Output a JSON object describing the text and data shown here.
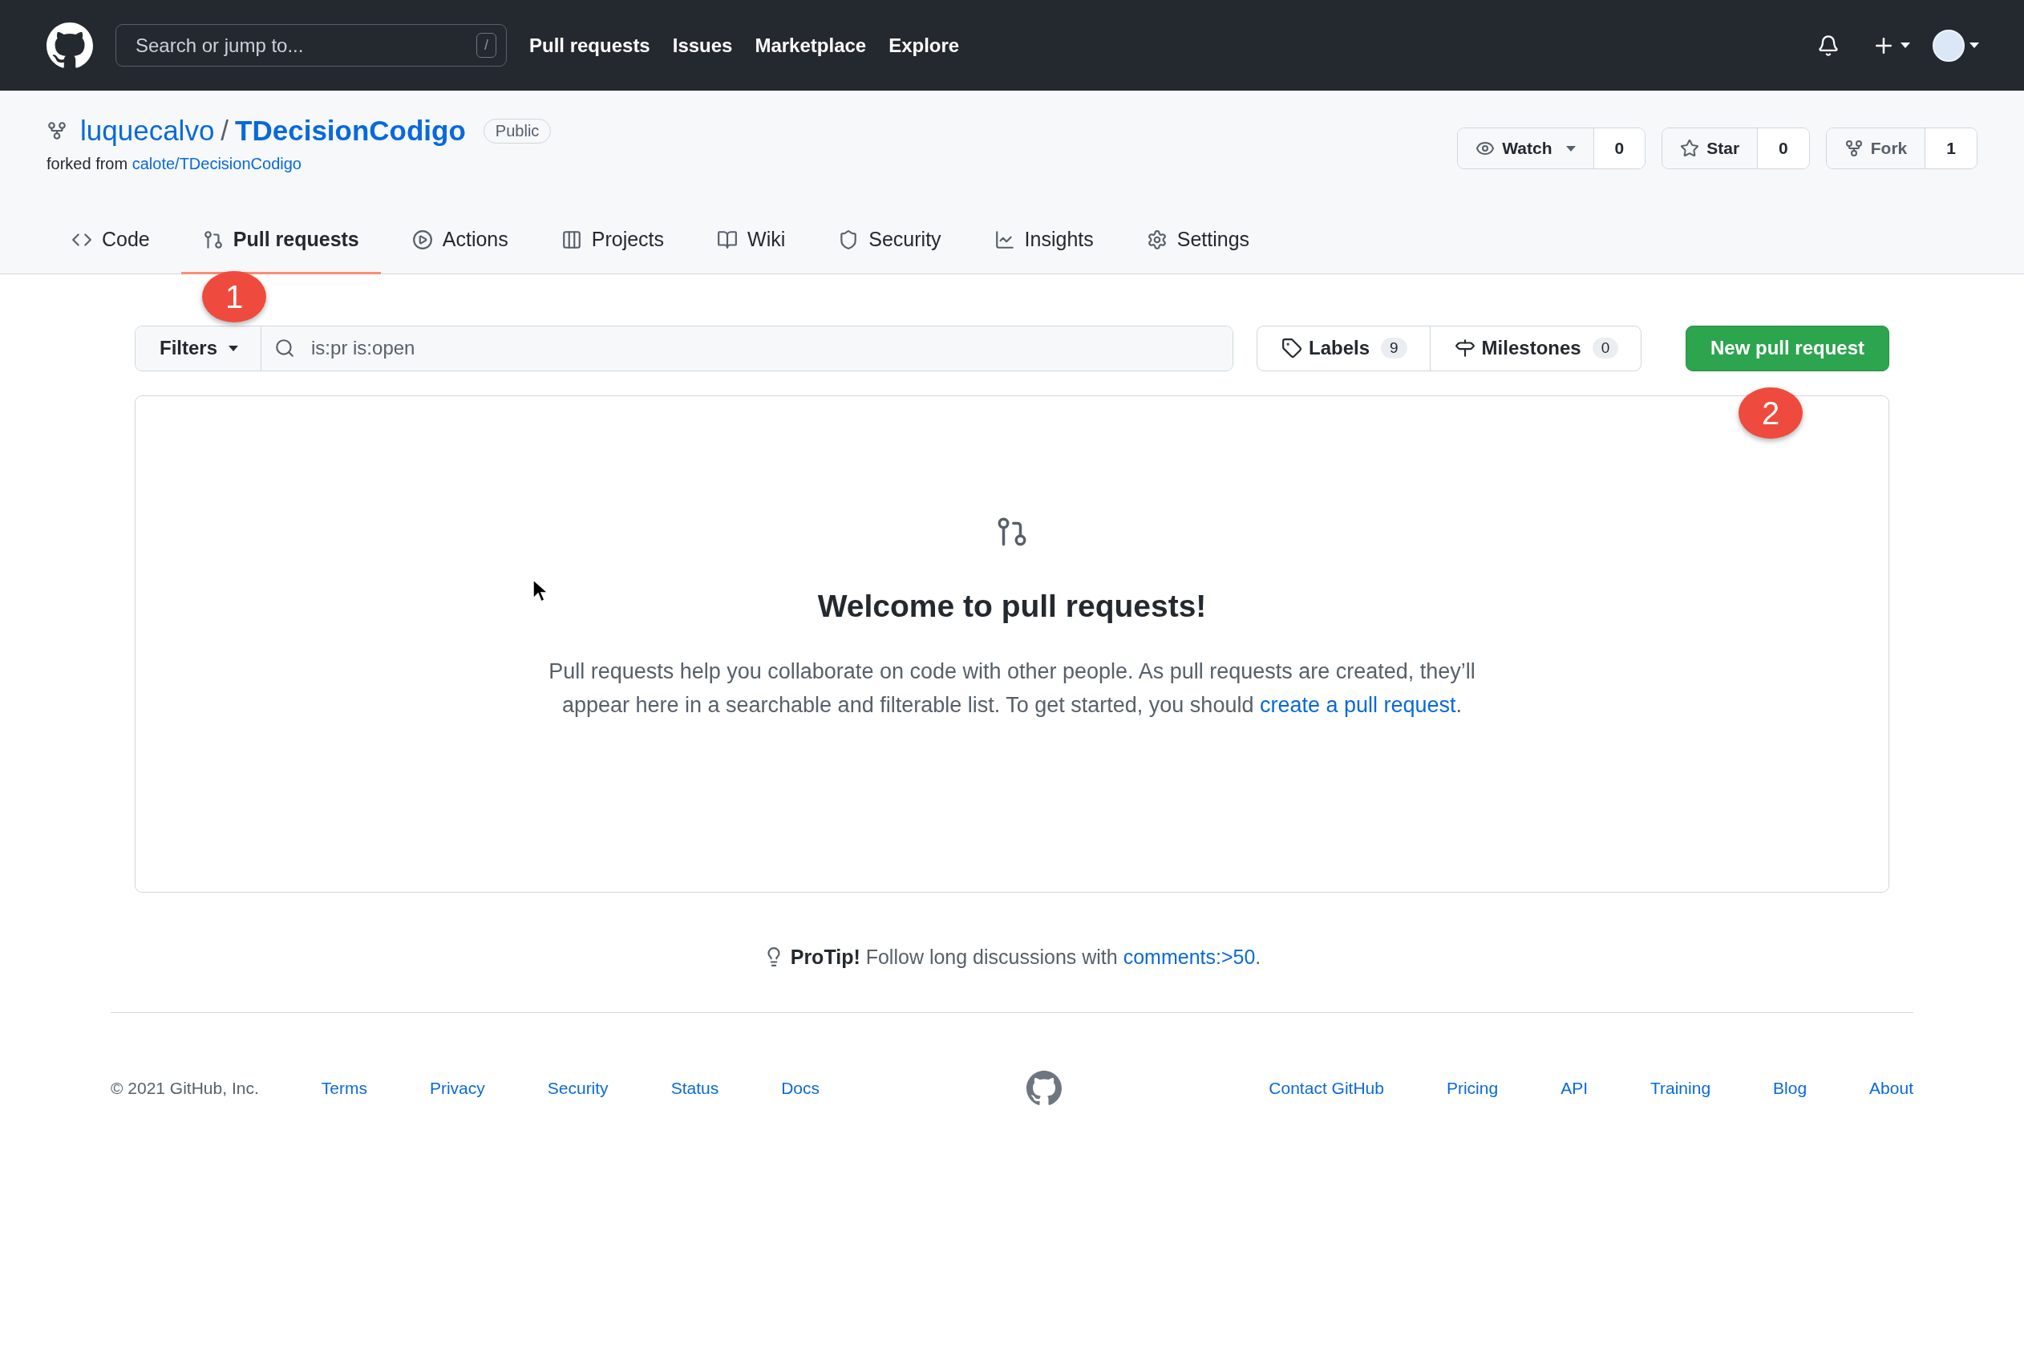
{
  "header": {
    "search": {
      "placeholder": "Search or jump to..."
    },
    "search_key": "/",
    "nav": [
      "Pull requests",
      "Issues",
      "Marketplace",
      "Explore"
    ]
  },
  "repo": {
    "owner": "luquecalvo",
    "separator": "/",
    "name": "TDecisionCodigo",
    "visibility": "Public",
    "forked_prefix": "forked from",
    "forked_from": "calote/TDecisionCodigo"
  },
  "repo_actions": [
    {
      "kind": "watch",
      "label": "Watch",
      "count": "0"
    },
    {
      "kind": "star",
      "label": "Star",
      "count": "0"
    },
    {
      "kind": "fork",
      "label": "Fork",
      "count": "1"
    }
  ],
  "tabs": [
    {
      "kind": "code",
      "label": "Code",
      "selected": false
    },
    {
      "kind": "pulls",
      "label": "Pull requests",
      "selected": true
    },
    {
      "kind": "actions",
      "label": "Actions",
      "selected": false
    },
    {
      "kind": "projects",
      "label": "Projects",
      "selected": false
    },
    {
      "kind": "wiki",
      "label": "Wiki",
      "selected": false
    },
    {
      "kind": "security",
      "label": "Security",
      "selected": false
    },
    {
      "kind": "insights",
      "label": "Insights",
      "selected": false
    },
    {
      "kind": "settings",
      "label": "Settings",
      "selected": false
    }
  ],
  "toolbar": {
    "filters": "Filters",
    "search": {
      "value": "is:pr is:open"
    },
    "labels": {
      "label": "Labels",
      "count": "9"
    },
    "milestones": {
      "label": "Milestones",
      "count": "0"
    },
    "new_button": "New pull request"
  },
  "blankslate": {
    "title": "Welcome to pull requests!",
    "text": "Pull requests help you collaborate on code with other people. As pull requests are created, they’ll appear here in a searchable and filterable list. To get started, you should ",
    "link": "create a pull request",
    "end": "."
  },
  "protip": {
    "text": "**ProTip!** Follow long discussions with ",
    "link": "comments:>50",
    "end": "."
  },
  "footer": {
    "copyright": "© 2021 GitHub, Inc.",
    "left_links": [
      "Terms",
      "Privacy",
      "Security",
      "Status",
      "Docs"
    ],
    "right_links": [
      "Contact GitHub",
      "Pricing",
      "API",
      "Training",
      "Blog",
      "About"
    ]
  },
  "annotations": [
    "1",
    "2"
  ]
}
